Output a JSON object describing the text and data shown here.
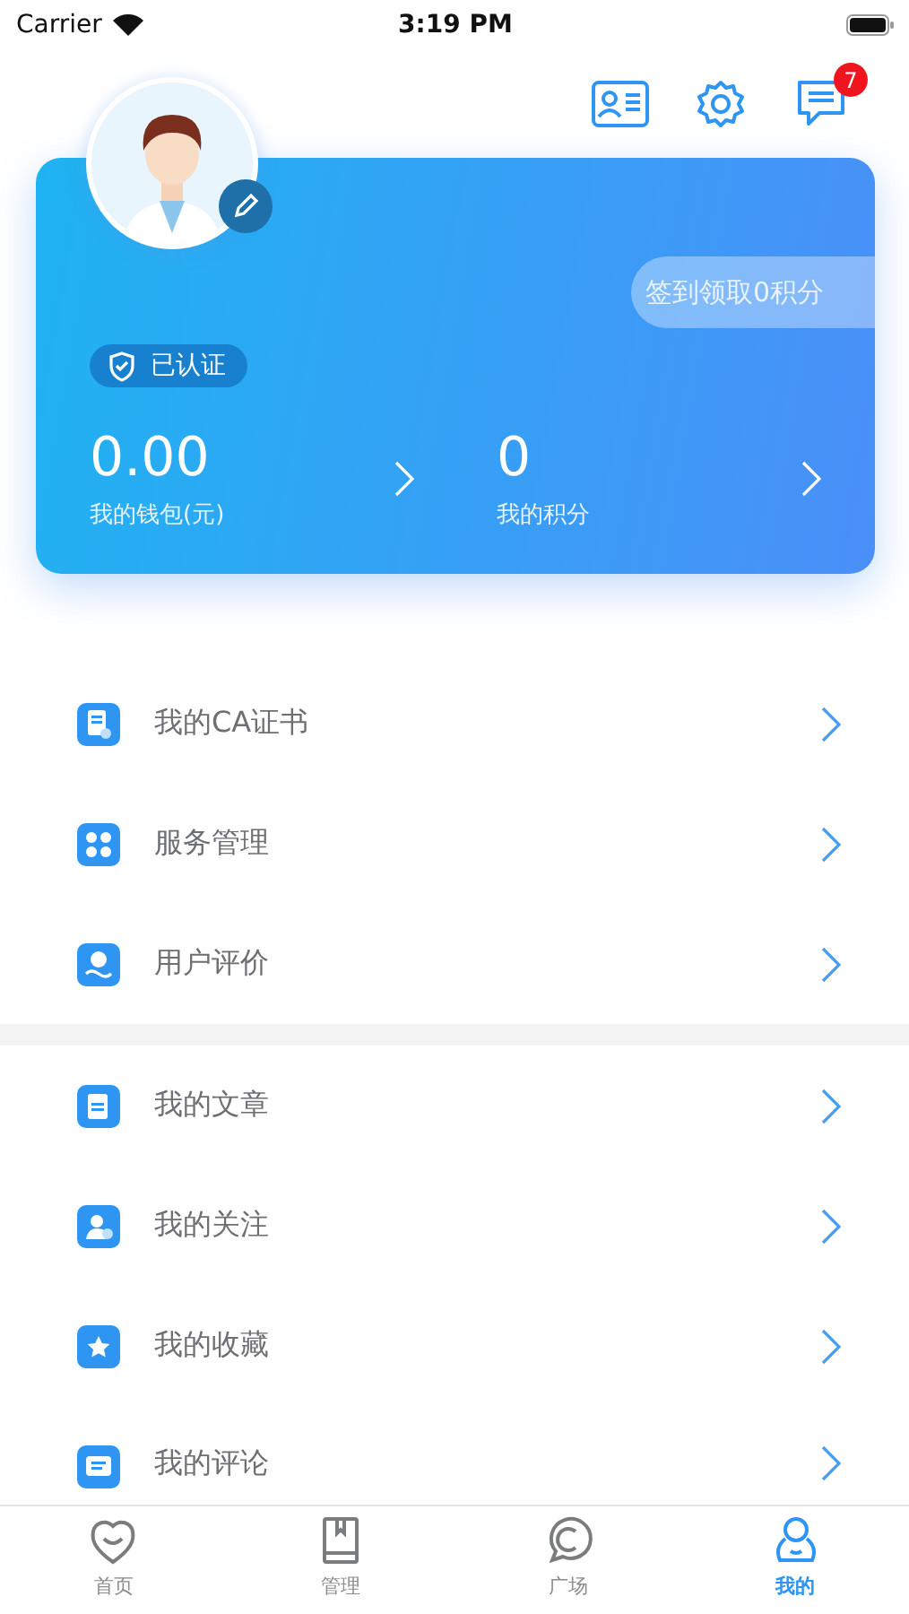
{
  "status_bar": {
    "carrier": "Carrier",
    "time": "3:19 PM"
  },
  "header": {
    "message_badge": "7"
  },
  "profile": {
    "verified_label": "已认证",
    "sign_in_button": "签到领取0积分",
    "stats": [
      {
        "value": "0.00",
        "label": "我的钱包(元)"
      },
      {
        "value": "0",
        "label": "我的积分"
      }
    ]
  },
  "menu_groups": [
    {
      "items": [
        {
          "label": "我的CA证书"
        },
        {
          "label": "服务管理"
        },
        {
          "label": "用户评价"
        }
      ]
    },
    {
      "items": [
        {
          "label": "我的文章"
        },
        {
          "label": "我的关注"
        },
        {
          "label": "我的收藏"
        },
        {
          "label": "我的评论"
        }
      ]
    }
  ],
  "tab_bar": [
    {
      "label": "首页",
      "selected": false
    },
    {
      "label": "管理",
      "selected": false
    },
    {
      "label": "广场",
      "selected": false
    },
    {
      "label": "我的",
      "selected": true
    }
  ]
}
